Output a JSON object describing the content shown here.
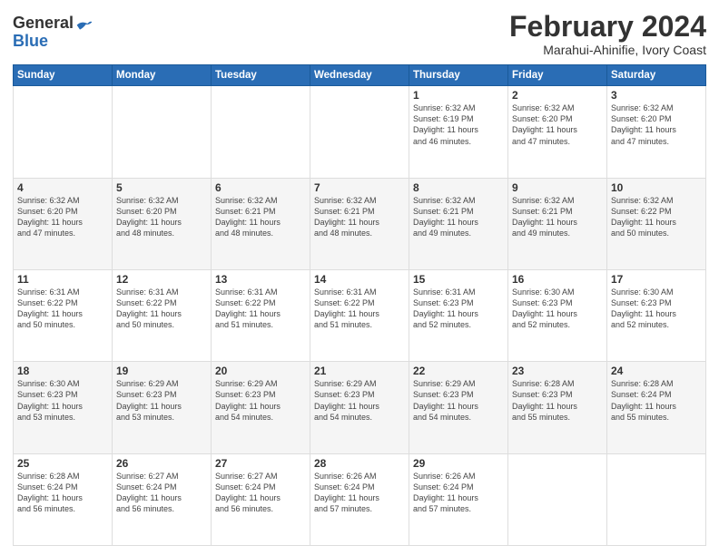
{
  "header": {
    "logo": {
      "line1": "General",
      "line2": "Blue"
    },
    "title": "February 2024",
    "location": "Marahui-Ahinifie, Ivory Coast"
  },
  "days_of_week": [
    "Sunday",
    "Monday",
    "Tuesday",
    "Wednesday",
    "Thursday",
    "Friday",
    "Saturday"
  ],
  "weeks": [
    [
      {
        "day": "",
        "info": ""
      },
      {
        "day": "",
        "info": ""
      },
      {
        "day": "",
        "info": ""
      },
      {
        "day": "",
        "info": ""
      },
      {
        "day": "1",
        "info": "Sunrise: 6:32 AM\nSunset: 6:19 PM\nDaylight: 11 hours\nand 46 minutes."
      },
      {
        "day": "2",
        "info": "Sunrise: 6:32 AM\nSunset: 6:20 PM\nDaylight: 11 hours\nand 47 minutes."
      },
      {
        "day": "3",
        "info": "Sunrise: 6:32 AM\nSunset: 6:20 PM\nDaylight: 11 hours\nand 47 minutes."
      }
    ],
    [
      {
        "day": "4",
        "info": "Sunrise: 6:32 AM\nSunset: 6:20 PM\nDaylight: 11 hours\nand 47 minutes."
      },
      {
        "day": "5",
        "info": "Sunrise: 6:32 AM\nSunset: 6:20 PM\nDaylight: 11 hours\nand 48 minutes."
      },
      {
        "day": "6",
        "info": "Sunrise: 6:32 AM\nSunset: 6:21 PM\nDaylight: 11 hours\nand 48 minutes."
      },
      {
        "day": "7",
        "info": "Sunrise: 6:32 AM\nSunset: 6:21 PM\nDaylight: 11 hours\nand 48 minutes."
      },
      {
        "day": "8",
        "info": "Sunrise: 6:32 AM\nSunset: 6:21 PM\nDaylight: 11 hours\nand 49 minutes."
      },
      {
        "day": "9",
        "info": "Sunrise: 6:32 AM\nSunset: 6:21 PM\nDaylight: 11 hours\nand 49 minutes."
      },
      {
        "day": "10",
        "info": "Sunrise: 6:32 AM\nSunset: 6:22 PM\nDaylight: 11 hours\nand 50 minutes."
      }
    ],
    [
      {
        "day": "11",
        "info": "Sunrise: 6:31 AM\nSunset: 6:22 PM\nDaylight: 11 hours\nand 50 minutes."
      },
      {
        "day": "12",
        "info": "Sunrise: 6:31 AM\nSunset: 6:22 PM\nDaylight: 11 hours\nand 50 minutes."
      },
      {
        "day": "13",
        "info": "Sunrise: 6:31 AM\nSunset: 6:22 PM\nDaylight: 11 hours\nand 51 minutes."
      },
      {
        "day": "14",
        "info": "Sunrise: 6:31 AM\nSunset: 6:22 PM\nDaylight: 11 hours\nand 51 minutes."
      },
      {
        "day": "15",
        "info": "Sunrise: 6:31 AM\nSunset: 6:23 PM\nDaylight: 11 hours\nand 52 minutes."
      },
      {
        "day": "16",
        "info": "Sunrise: 6:30 AM\nSunset: 6:23 PM\nDaylight: 11 hours\nand 52 minutes."
      },
      {
        "day": "17",
        "info": "Sunrise: 6:30 AM\nSunset: 6:23 PM\nDaylight: 11 hours\nand 52 minutes."
      }
    ],
    [
      {
        "day": "18",
        "info": "Sunrise: 6:30 AM\nSunset: 6:23 PM\nDaylight: 11 hours\nand 53 minutes."
      },
      {
        "day": "19",
        "info": "Sunrise: 6:29 AM\nSunset: 6:23 PM\nDaylight: 11 hours\nand 53 minutes."
      },
      {
        "day": "20",
        "info": "Sunrise: 6:29 AM\nSunset: 6:23 PM\nDaylight: 11 hours\nand 54 minutes."
      },
      {
        "day": "21",
        "info": "Sunrise: 6:29 AM\nSunset: 6:23 PM\nDaylight: 11 hours\nand 54 minutes."
      },
      {
        "day": "22",
        "info": "Sunrise: 6:29 AM\nSunset: 6:23 PM\nDaylight: 11 hours\nand 54 minutes."
      },
      {
        "day": "23",
        "info": "Sunrise: 6:28 AM\nSunset: 6:23 PM\nDaylight: 11 hours\nand 55 minutes."
      },
      {
        "day": "24",
        "info": "Sunrise: 6:28 AM\nSunset: 6:24 PM\nDaylight: 11 hours\nand 55 minutes."
      }
    ],
    [
      {
        "day": "25",
        "info": "Sunrise: 6:28 AM\nSunset: 6:24 PM\nDaylight: 11 hours\nand 56 minutes."
      },
      {
        "day": "26",
        "info": "Sunrise: 6:27 AM\nSunset: 6:24 PM\nDaylight: 11 hours\nand 56 minutes."
      },
      {
        "day": "27",
        "info": "Sunrise: 6:27 AM\nSunset: 6:24 PM\nDaylight: 11 hours\nand 56 minutes."
      },
      {
        "day": "28",
        "info": "Sunrise: 6:26 AM\nSunset: 6:24 PM\nDaylight: 11 hours\nand 57 minutes."
      },
      {
        "day": "29",
        "info": "Sunrise: 6:26 AM\nSunset: 6:24 PM\nDaylight: 11 hours\nand 57 minutes."
      },
      {
        "day": "",
        "info": ""
      },
      {
        "day": "",
        "info": ""
      }
    ]
  ]
}
